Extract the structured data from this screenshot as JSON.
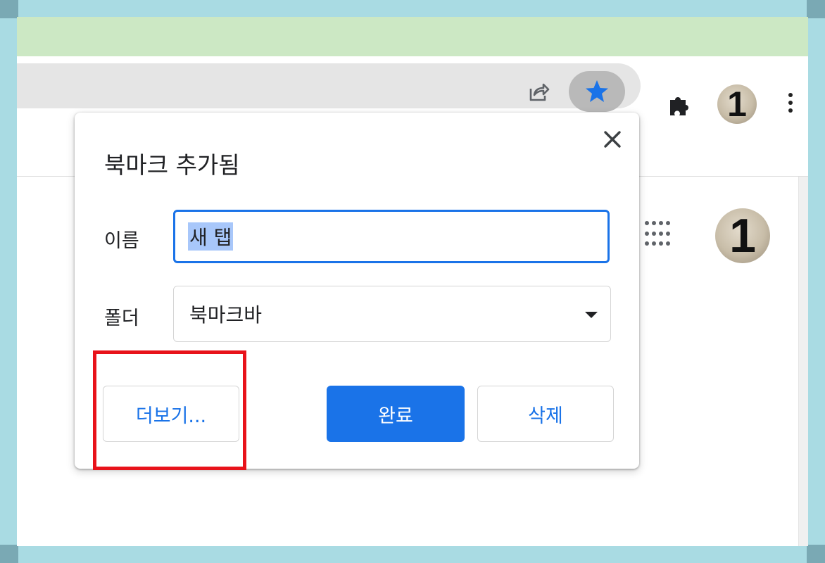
{
  "dialog": {
    "title": "북마크 추가됨",
    "name_label": "이름",
    "name_value": "새 탭",
    "folder_label": "폴더",
    "folder_value": "북마크바",
    "more_button": "더보기...",
    "done_button": "완료",
    "delete_button": "삭제"
  },
  "toolbar": {
    "avatar_text": "1"
  },
  "page": {
    "avatar_text": "1"
  },
  "colors": {
    "accent": "#1a73e8",
    "highlight": "#e8121a",
    "frame": "#a9dbe3",
    "top_strip": "#cce8c4"
  },
  "icons": {
    "share": "share-icon",
    "star": "bookmark-star-icon",
    "extensions": "puzzle-icon",
    "menu": "kebab-menu-icon",
    "close": "close-icon",
    "apps": "apps-grid-icon"
  }
}
